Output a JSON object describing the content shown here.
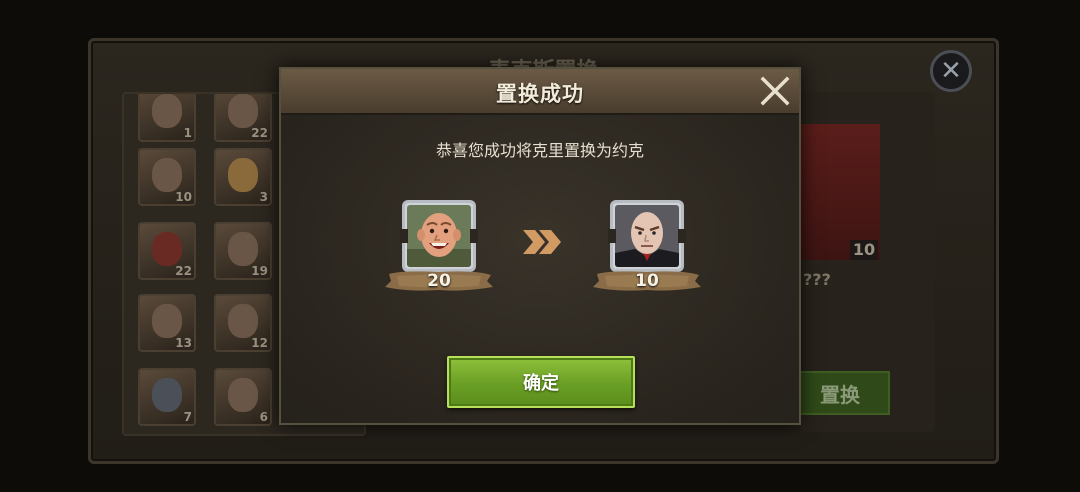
{
  "background": {
    "panel_title": "choose replace",
    "list_levels": [
      "1",
      "22",
      "10",
      "3",
      "22",
      "19",
      "13",
      "12",
      "7",
      "6"
    ],
    "selected_level": "10",
    "selected_name": "???",
    "replace_button_label": "置换"
  },
  "modal": {
    "title": "置换成功",
    "message": "恭喜您成功将克里置换为约克",
    "from_hero": {
      "icon": "bald-smiling-man-portrait",
      "level": "20"
    },
    "to_hero": {
      "icon": "bald-serious-man-portrait",
      "level": "10"
    },
    "arrow_icon": "double-chevron-right-icon",
    "confirm_label": "确定"
  }
}
